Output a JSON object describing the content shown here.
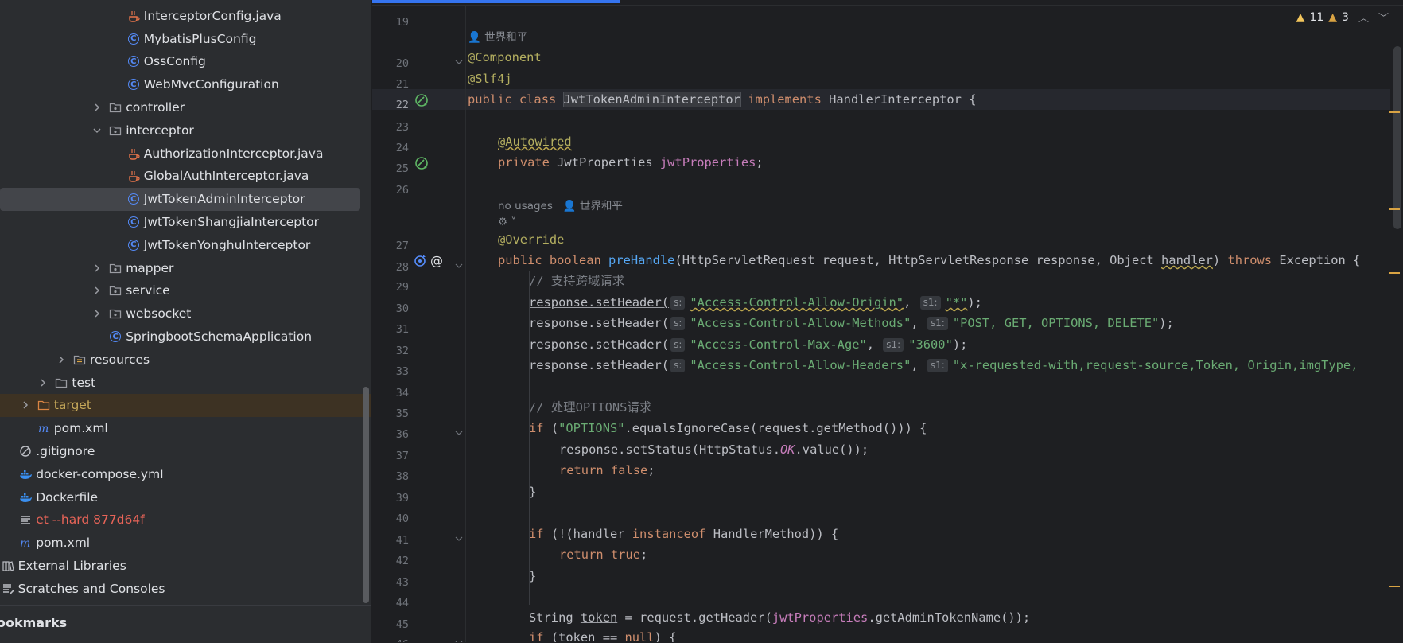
{
  "project_tree": {
    "items": [
      {
        "label": "InterceptorConfig.java",
        "icon": "java-file-icon",
        "depth": 8,
        "arrow": "none"
      },
      {
        "label": "MybatisPlusConfig",
        "icon": "class-icon",
        "depth": 8,
        "arrow": "none"
      },
      {
        "label": "OssConfig",
        "icon": "class-icon",
        "depth": 8,
        "arrow": "none"
      },
      {
        "label": "WebMvcConfiguration",
        "icon": "class-icon",
        "depth": 8,
        "arrow": "none"
      },
      {
        "label": "controller",
        "icon": "package-icon",
        "depth": 7,
        "arrow": "collapsed"
      },
      {
        "label": "interceptor",
        "icon": "package-icon",
        "depth": 7,
        "arrow": "expanded"
      },
      {
        "label": "AuthorizationInterceptor.java",
        "icon": "java-file-icon",
        "depth": 8,
        "arrow": "none"
      },
      {
        "label": "GlobalAuthInterceptor.java",
        "icon": "java-file-icon",
        "depth": 8,
        "arrow": "none"
      },
      {
        "label": "JwtTokenAdminInterceptor",
        "icon": "class-icon",
        "depth": 8,
        "arrow": "none",
        "selected": true
      },
      {
        "label": "JwtTokenShangjiaInterceptor",
        "icon": "class-icon",
        "depth": 8,
        "arrow": "none"
      },
      {
        "label": "JwtTokenYonghuInterceptor",
        "icon": "class-icon",
        "depth": 8,
        "arrow": "none"
      },
      {
        "label": "mapper",
        "icon": "package-icon",
        "depth": 7,
        "arrow": "collapsed"
      },
      {
        "label": "service",
        "icon": "package-icon",
        "depth": 7,
        "arrow": "collapsed"
      },
      {
        "label": "websocket",
        "icon": "package-icon",
        "depth": 7,
        "arrow": "collapsed"
      },
      {
        "label": "SpringbootSchemaApplication",
        "icon": "spring-boot-class-icon",
        "depth": 7,
        "arrow": "none"
      },
      {
        "label": "resources",
        "icon": "resources-folder-icon",
        "depth": 5,
        "arrow": "collapsed"
      },
      {
        "label": "test",
        "icon": "folder-icon",
        "depth": 4,
        "arrow": "collapsed"
      },
      {
        "label": "target",
        "icon": "excluded-folder-icon",
        "depth": 3,
        "arrow": "collapsed",
        "style": "orange"
      },
      {
        "label": "pom.xml",
        "icon": "maven-icon",
        "depth": 3,
        "arrow": "none"
      },
      {
        "label": ".gitignore",
        "icon": "ignore-file-icon",
        "depth": 2,
        "arrow": "none"
      },
      {
        "label": "docker-compose.yml",
        "icon": "docker-icon",
        "depth": 2,
        "arrow": "none"
      },
      {
        "label": "Dockerfile",
        "icon": "docker-icon",
        "depth": 2,
        "arrow": "none"
      },
      {
        "label": "et --hard 877d64f",
        "icon": "text-file-icon",
        "depth": 2,
        "arrow": "none",
        "style": "red"
      },
      {
        "label": "pom.xml",
        "icon": "maven-icon",
        "depth": 2,
        "arrow": "none"
      },
      {
        "label": "External Libraries",
        "icon": "libraries-icon",
        "depth": 1,
        "arrow": "collapsed"
      },
      {
        "label": "Scratches and Consoles",
        "icon": "scratches-icon",
        "depth": 1,
        "arrow": "collapsed"
      }
    ]
  },
  "bookmarks_label": "ookmarks",
  "inspections": {
    "warnings": "11",
    "weak_warnings": "3"
  },
  "editor": {
    "line_numbers": [
      "19",
      "20",
      "21",
      "22",
      "23",
      "24",
      "25",
      "26",
      "27",
      "28",
      "29",
      "30",
      "31",
      "32",
      "33",
      "34",
      "35",
      "36",
      "37",
      "38",
      "39",
      "40",
      "41",
      "42",
      "43",
      "44",
      "45",
      "46"
    ],
    "author_hint": "世界和平",
    "usages_hint": "no usages",
    "lines": {
      "l20": "@Component",
      "l21": "@Slf4j",
      "l22_public": "public",
      "l22_class": "class",
      "l22_name": "JwtTokenAdminInterceptor",
      "l22_impl": "implements",
      "l22_rest": "HandlerInterceptor {",
      "l24": "@Autowired",
      "l25_private": "private",
      "l25_type": "JwtProperties",
      "l25_field": "jwtProperties",
      "l27": "@Override",
      "l28_public": "public",
      "l28_bool": "boolean",
      "l28_fn": "preHandle",
      "l28_params": "(HttpServletRequest request, HttpServletResponse response, Object",
      "l28_handler": "handler",
      "l28_close": ")",
      "l28_throws": "throws",
      "l28_exc": "Exception {",
      "l29": "// 支持跨域请求",
      "set_header": "response.setHeader(",
      "hint_s": "s:",
      "hint_s1": "s1:",
      "l30_k": "\"Access-Control-Allow-Origin\"",
      "l30_v": "\"*\"",
      "l31_k": "\"Access-Control-Allow-Methods\"",
      "l31_v": "\"POST, GET, OPTIONS, DELETE\"",
      "l32_k": "\"Access-Control-Max-Age\"",
      "l32_v": "\"3600\"",
      "l33_k": "\"Access-Control-Allow-Headers\"",
      "l33_v": "\"x-requested-with,request-source,Token, Origin,imgType,",
      "l35": "// 处理OPTIONS请求",
      "l36_if": "if",
      "l36_str": "\"OPTIONS\"",
      "l36_rest": ".equalsIgnoreCase(request.getMethod())) {",
      "l37_a": "response.setStatus(HttpStatus.",
      "l37_ok": "OK",
      "l37_b": ".value());",
      "l38_return": "return",
      "l38_false": "false",
      "l39": "}",
      "l41_if": "if",
      "l41_a": "(!(handler",
      "l41_inst": "instanceof",
      "l41_b": "HandlerMethod)) {",
      "l42_return": "return",
      "l42_true": "true",
      "l43": "}",
      "l45_type": "String",
      "l45_var": "token",
      "l45_a": "= request.getHeader(",
      "l45_fld": "jwtProperties",
      "l45_b": ".getAdminTokenName());",
      "l46_if": "if",
      "l46_a": "(token ==",
      "l46_null": "null",
      "l46_b": ") {"
    }
  }
}
